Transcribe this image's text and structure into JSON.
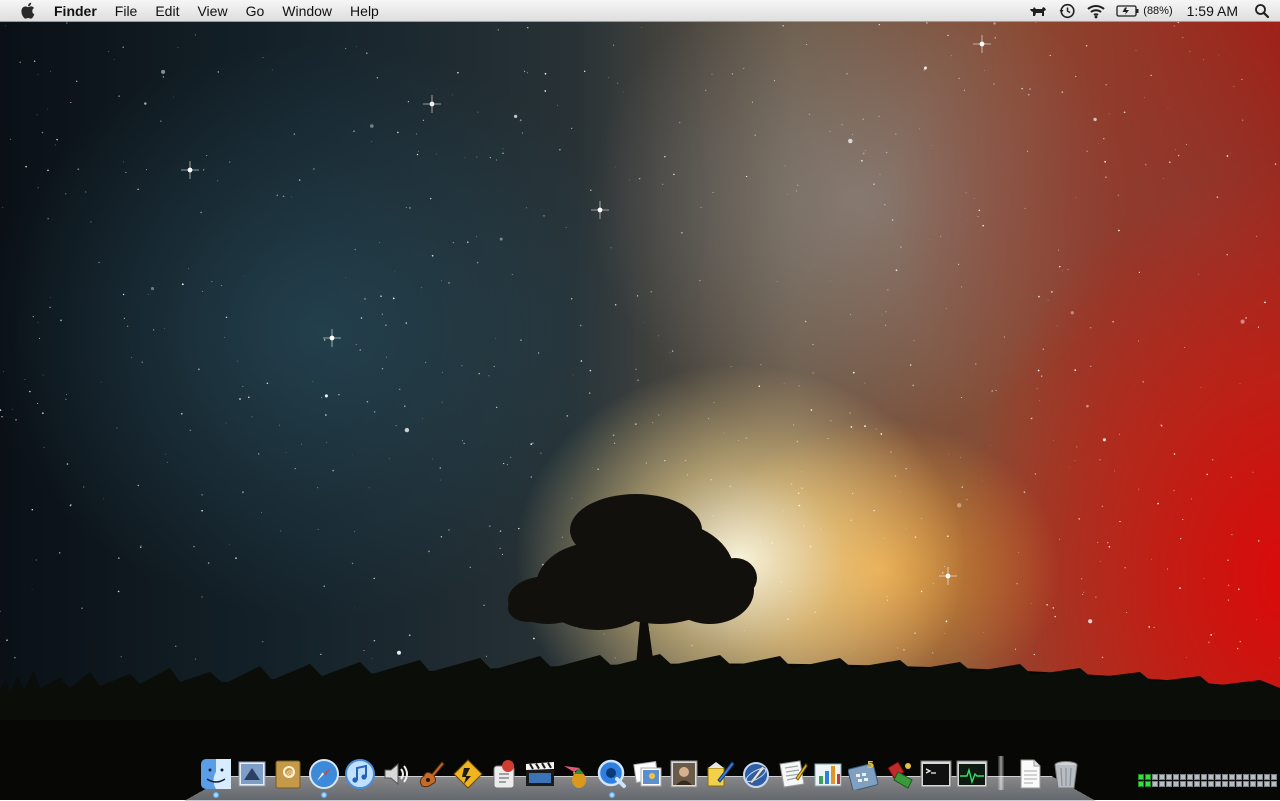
{
  "menubar": {
    "app_name": "Finder",
    "menus": [
      "File",
      "Edit",
      "View",
      "Go",
      "Window",
      "Help"
    ],
    "battery_percent": "(88%)",
    "clock": "1:59 AM",
    "status_icons": [
      "dog-icon",
      "time-machine-icon",
      "wifi-icon",
      "battery-icon",
      "spotlight-icon"
    ]
  },
  "dock": {
    "apps": [
      {
        "name": "finder",
        "running": true
      },
      {
        "name": "mail",
        "running": false
      },
      {
        "name": "address-book",
        "running": false
      },
      {
        "name": "safari",
        "running": true
      },
      {
        "name": "itunes",
        "running": false
      },
      {
        "name": "audio",
        "running": false
      },
      {
        "name": "garageband",
        "running": false
      },
      {
        "name": "vlc",
        "running": false
      },
      {
        "name": "script-editor",
        "running": false
      },
      {
        "name": "imovie",
        "running": false
      },
      {
        "name": "adium",
        "running": false
      },
      {
        "name": "quicktime",
        "running": true
      },
      {
        "name": "iphoto",
        "running": false
      },
      {
        "name": "photo-booth",
        "running": false
      },
      {
        "name": "paint",
        "running": false
      },
      {
        "name": "xcode",
        "running": false
      },
      {
        "name": "pages",
        "running": false
      },
      {
        "name": "numbers",
        "running": false
      },
      {
        "name": "calculator",
        "running": false
      },
      {
        "name": "dictionary",
        "running": false
      },
      {
        "name": "terminal",
        "running": false
      },
      {
        "name": "activity-monitor",
        "running": false
      }
    ],
    "stacks": [
      "documents",
      "trash"
    ]
  },
  "spaces_meter": {
    "active_cells": 2,
    "total_cells": 40
  },
  "colors": {
    "accent_blue": "#2f7fe0",
    "meter_on": "#32e23a"
  }
}
